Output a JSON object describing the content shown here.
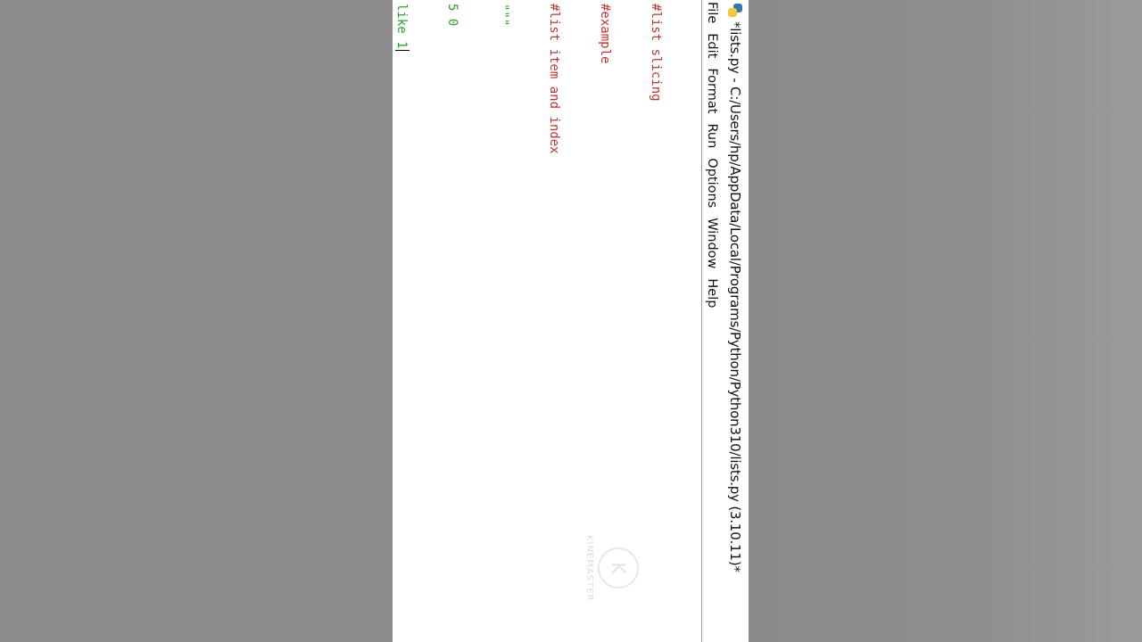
{
  "window": {
    "title": "*lists.py - C:/Users/hp/AppData/Local/Programs/Python/Python310/lists.py (3.10.11)*",
    "icon": "python-icon"
  },
  "menubar": {
    "items": [
      "File",
      "Edit",
      "Format",
      "Run",
      "Options",
      "Window",
      "Help"
    ]
  },
  "editor": {
    "lines": [
      {
        "text": "#list slicing",
        "kind": "comment"
      },
      {
        "text": "#example",
        "kind": "comment"
      },
      {
        "text": "#list item and index",
        "kind": "comment"
      },
      {
        "text": "\"\"\"",
        "kind": "string"
      },
      {
        "text": "5 0",
        "kind": "string"
      },
      {
        "text": "like 1",
        "kind": "string"
      },
      {
        "text": "\"\"\"",
        "kind": "string"
      }
    ],
    "colors": {
      "comment": "#c0332e",
      "string": "#2ca02c"
    }
  },
  "watermark": {
    "logo": "K",
    "text": "KINEMASTER"
  }
}
